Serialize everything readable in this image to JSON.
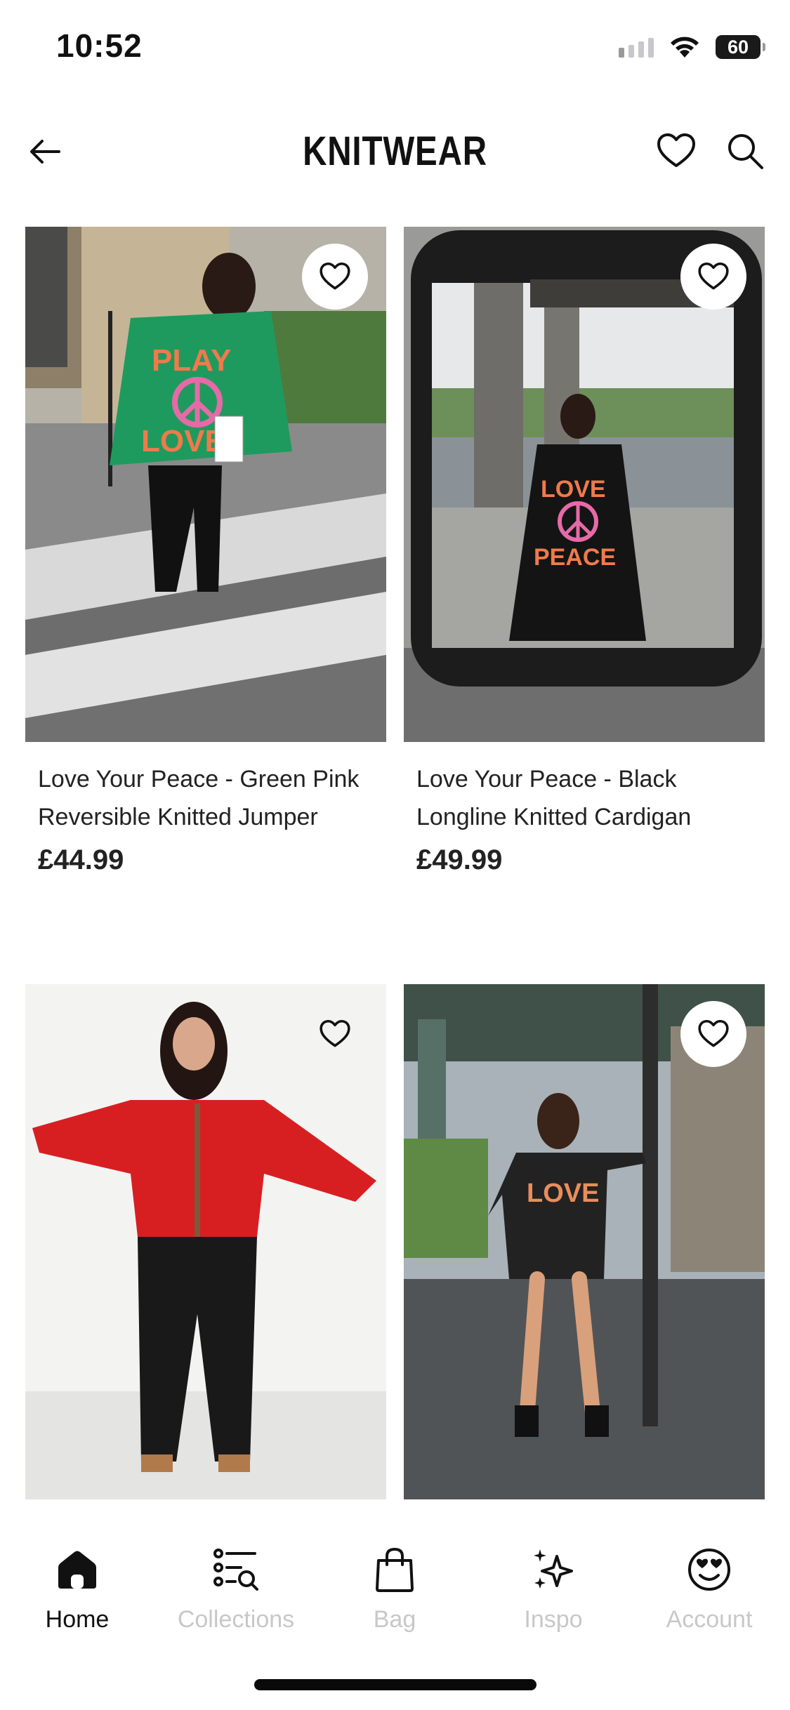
{
  "status_bar": {
    "time": "10:52",
    "battery": "60"
  },
  "header": {
    "title": "KNITWEAR",
    "back_icon": "arrow-left-icon",
    "wishlist_icon": "heart-icon",
    "search_icon": "search-icon"
  },
  "products": [
    {
      "name": "Love Your Peace - Green Pink Reversible Knitted Jumper",
      "price": "£44.99"
    },
    {
      "name": "Love Your Peace - Black Longline Knitted Cardigan",
      "price": "£49.99"
    },
    {
      "name": "",
      "price": ""
    },
    {
      "name": "",
      "price": ""
    }
  ],
  "tabs": [
    {
      "label": "Home",
      "icon": "home-icon",
      "active": true
    },
    {
      "label": "Collections",
      "icon": "collections-list-icon",
      "active": false
    },
    {
      "label": "Bag",
      "icon": "bag-icon",
      "active": false
    },
    {
      "label": "Inspo",
      "icon": "sparkles-icon",
      "active": false
    },
    {
      "label": "Account",
      "icon": "smiley-heart-eyes-icon",
      "active": false
    }
  ],
  "colors": {
    "active": "#111111",
    "inactive": "#c8c8c8",
    "background": "#ffffff"
  }
}
